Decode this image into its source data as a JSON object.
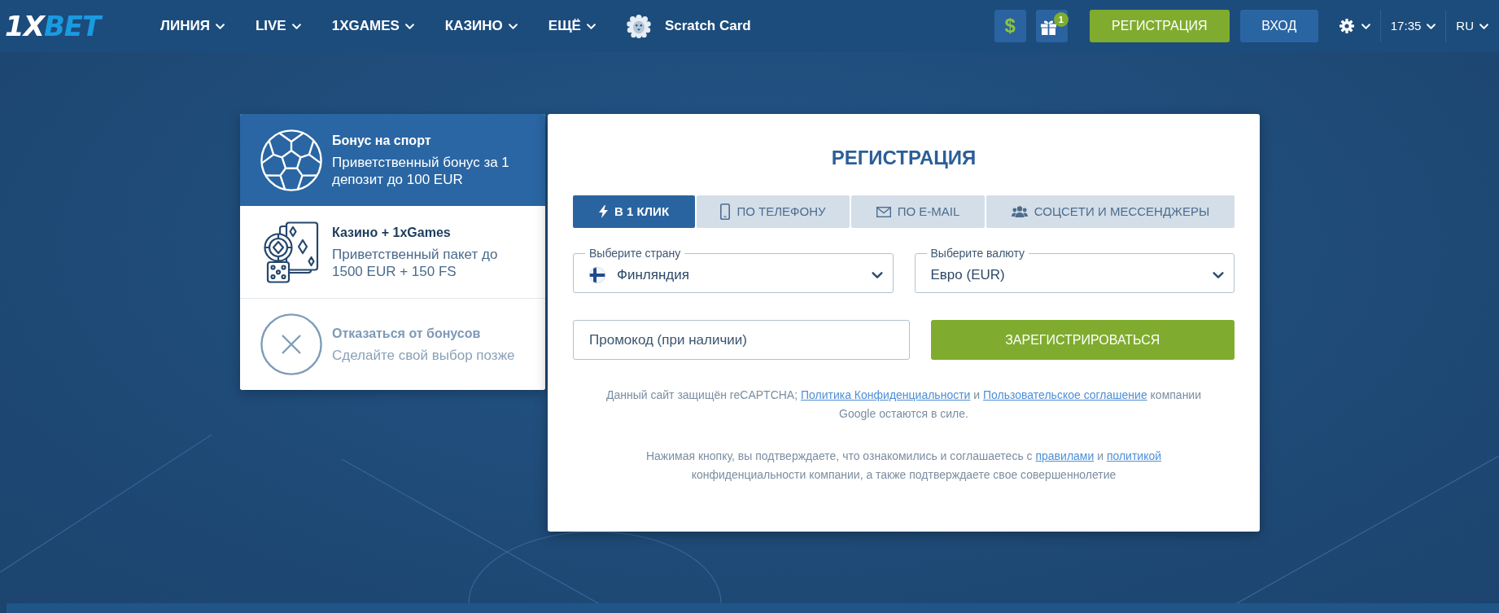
{
  "header": {
    "logo": {
      "lead": "1X",
      "rest": "BET"
    },
    "nav": [
      {
        "label": "ЛИНИЯ",
        "kind": "menu"
      },
      {
        "label": "LIVE",
        "kind": "menu"
      },
      {
        "label": "1XGAMES",
        "kind": "menu"
      },
      {
        "label": "КАЗИНО",
        "kind": "menu"
      },
      {
        "label": "ЕЩЁ",
        "kind": "menu"
      },
      {
        "label": "Scratch Card",
        "kind": "promo"
      }
    ],
    "currency_button": "$",
    "gift_badge": "1",
    "register_button": "РЕГИСТРАЦИЯ",
    "login_button": "ВХОД",
    "time": "17:35",
    "language": "RU"
  },
  "bonuses": [
    {
      "kind": "sport",
      "title": "Бонус на спорт",
      "description": "Приветственный бонус за 1 депозит до 100 EUR",
      "selected": true
    },
    {
      "kind": "casino",
      "title": "Казино + 1xGames",
      "description": "Приветственный пакет до 1500 EUR + 150 FS",
      "selected": false
    },
    {
      "kind": "decline",
      "title": "Отказаться от бонусов",
      "description": "Сделайте свой выбор позже",
      "selected": false
    }
  ],
  "registration": {
    "title": "РЕГИСТРАЦИЯ",
    "tabs": [
      {
        "label": "В 1 КЛИК",
        "kind": "one_click",
        "selected": true
      },
      {
        "label": "ПО ТЕЛЕФОНУ",
        "kind": "phone",
        "selected": false
      },
      {
        "label": "ПО E-MAIL",
        "kind": "email",
        "selected": false
      },
      {
        "label": "СОЦСЕТИ И МЕССЕНДЖЕРЫ",
        "kind": "social",
        "selected": false
      }
    ],
    "country": {
      "label": "Выберите страну",
      "value": "Финляндия"
    },
    "currency": {
      "label": "Выберите валюту",
      "value": "Евро (EUR)"
    },
    "promo": {
      "placeholder": "Промокод (при наличии)"
    },
    "submit": "ЗАРЕГИСТРИРОВАТЬСЯ",
    "notices": [
      [
        {
          "text": "Данный сайт защищён reCAPTCHA; "
        },
        {
          "link": "Политика Конфиденциальности"
        },
        {
          "text": " и "
        },
        {
          "link": "Пользовательское соглашение"
        },
        {
          "text": " компании Google остаются в силе."
        }
      ],
      [
        {
          "text": "Нажимая кнопку, вы подтверждаете, что ознакомились и соглашаетесь с "
        },
        {
          "link": "правилами"
        },
        {
          "text": " и "
        },
        {
          "link": "политикой"
        },
        {
          "text": " конфиденциальности компании, а также подтверждаете свое совершеннолетие"
        }
      ]
    ]
  }
}
